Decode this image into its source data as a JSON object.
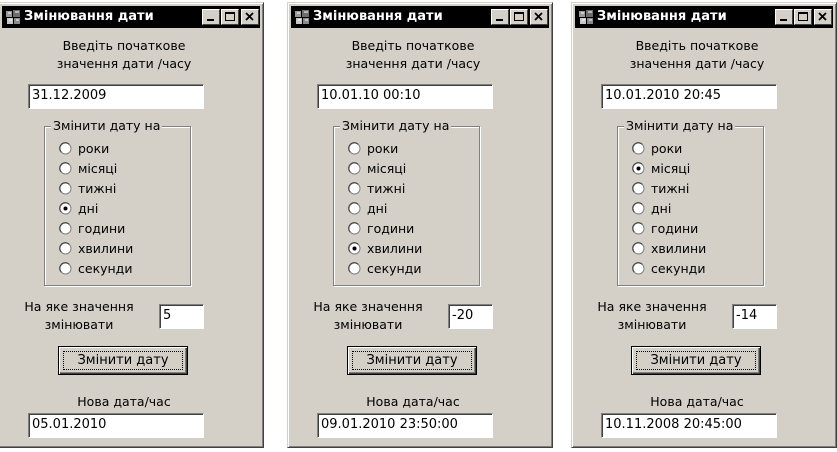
{
  "windows": [
    {
      "title": "Змінювання дати",
      "prompt_line1": "Введіть початкове",
      "prompt_line2": "значення дати /часу",
      "initial_value": "31.12.2009",
      "group_label": "Змінити дату  на",
      "options": [
        "роки",
        "місяці",
        "тижні",
        "дні",
        "години",
        "хвилини",
        "секунди"
      ],
      "selected_option": "дні",
      "change_label_line1": "На яке значення",
      "change_label_line2": "змінювати",
      "change_value": "5",
      "button_label": "Змінити дату",
      "result_label": "Нова дата/час",
      "result_value": "05.01.2010"
    },
    {
      "title": "Змінювання дати",
      "prompt_line1": "Введіть початкове",
      "prompt_line2": "значення дати /часу",
      "initial_value": "10.01.10  00:10",
      "group_label": "Змінити дату  на",
      "options": [
        "роки",
        "місяці",
        "тижні",
        "дні",
        "години",
        "хвилини",
        "секунди"
      ],
      "selected_option": "хвилини",
      "change_label_line1": "На яке значення",
      "change_label_line2": "змінювати",
      "change_value": "-20",
      "button_label": "Змінити дату",
      "result_label": "Нова дата/час",
      "result_value": "09.01.2010 23:50:00"
    },
    {
      "title": "Змінювання дати",
      "prompt_line1": "Введіть початкове",
      "prompt_line2": "значення дати /часу",
      "initial_value": "10.01.2010  20:45",
      "group_label": "Змінити дату  на",
      "options": [
        "роки",
        "місяці",
        "тижні",
        "дні",
        "години",
        "хвилини",
        "секунди"
      ],
      "selected_option": "місяці",
      "change_label_line1": "На яке значення",
      "change_label_line2": "змінювати",
      "change_value": "-14",
      "button_label": "Змінити дату",
      "result_label": "Нова дата/час",
      "result_value": "10.11.2008 20:45:00"
    }
  ],
  "icons": {
    "app": "app-icon",
    "minimize": "minimize-icon",
    "maximize": "maximize-icon",
    "close": "close-icon"
  }
}
